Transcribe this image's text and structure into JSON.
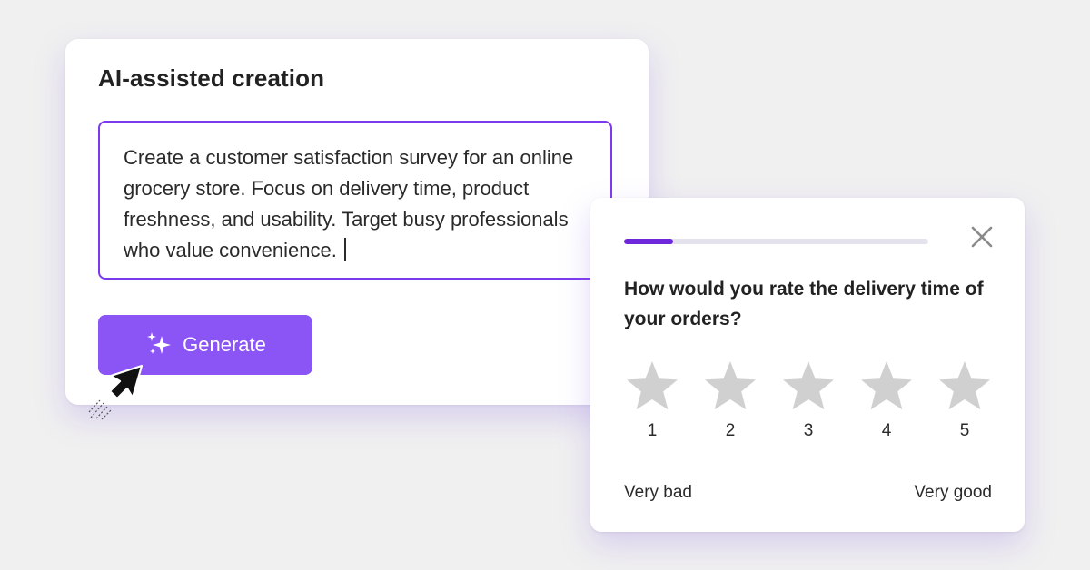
{
  "ai_card": {
    "title": "AI-assisted creation",
    "prompt_text": "Create a customer satisfaction survey for an online grocery store. Focus on delivery time, product freshness, and usability. Target busy professionals who value convenience.",
    "generate_label": "Generate",
    "generate_icon": "sparkle-icon",
    "cursor_icon": "pointer-cursor-icon"
  },
  "survey": {
    "progress": 0.16,
    "close_icon": "close-icon",
    "question": "How would you rate the delivery time of your orders?",
    "rating_icon": "star-icon",
    "ratings": [
      "1",
      "2",
      "3",
      "4",
      "5"
    ],
    "scale_low_label": "Very bad",
    "scale_high_label": "Very good"
  },
  "colors": {
    "background": "#f0f0f0",
    "accent_purple": "#7c3aed",
    "button_purple": "#8b55f6",
    "progress_fill": "#6d28d9",
    "progress_track": "#e4e2ec",
    "star_gray": "#d0d0d0",
    "close_gray": "#8a8a8a"
  }
}
